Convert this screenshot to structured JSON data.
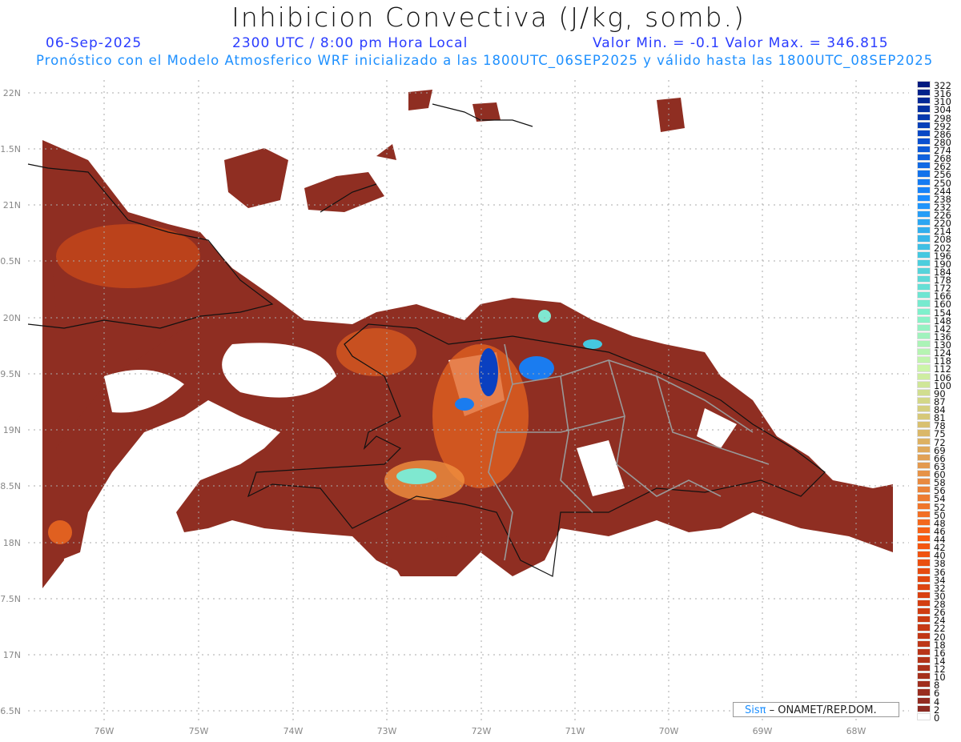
{
  "header": {
    "title": "Inhibicion Convectiva (J/kg, somb.)",
    "date": "06-Sep-2025",
    "time": "2300 UTC / 8:00 pm Hora Local",
    "minmax": "Valor Min. = -0.1  Valor Max. = 346.815",
    "model_line": "Pronóstico con el Modelo Atmosferico WRF inicializado a las 1800UTC_06SEP2025 y válido hasta las  1800UTC_08SEP2025"
  },
  "axes": {
    "lat_labels": [
      "22N",
      "1.5N",
      "21N",
      "0.5N",
      "20N",
      "9.5N",
      "19N",
      "8.5N",
      "18N",
      "7.5N",
      "17N",
      "6.5N"
    ],
    "lon_labels": [
      "76W",
      "75W",
      "74W",
      "73W",
      "72W",
      "71W",
      "70W",
      "69W",
      "68W"
    ]
  },
  "colorbar": {
    "levels": [
      "322",
      "316",
      "310",
      "304",
      "298",
      "292",
      "286",
      "280",
      "274",
      "268",
      "262",
      "256",
      "250",
      "244",
      "238",
      "232",
      "226",
      "220",
      "214",
      "208",
      "202",
      "196",
      "190",
      "184",
      "178",
      "172",
      "166",
      "160",
      "154",
      "148",
      "142",
      "136",
      "130",
      "124",
      "118",
      "112",
      "106",
      "100",
      "90",
      "87",
      "84",
      "81",
      "78",
      "75",
      "72",
      "69",
      "66",
      "63",
      "60",
      "58",
      "56",
      "54",
      "52",
      "50",
      "48",
      "46",
      "44",
      "42",
      "40",
      "38",
      "36",
      "34",
      "32",
      "30",
      "28",
      "26",
      "24",
      "22",
      "20",
      "18",
      "16",
      "14",
      "12",
      "10",
      "8",
      "6",
      "4",
      "2",
      "0"
    ],
    "stops": [
      "#001a80",
      "#0a50d0",
      "#1a8cff",
      "#45c8e0",
      "#7ff0cc",
      "#ccf5a8",
      "#d8c070",
      "#e88a40",
      "#f85a10",
      "#d84010",
      "#b83418",
      "#8c2a22",
      "#ffffff"
    ]
  },
  "credit": {
    "brand": "Sisπ",
    "text": " – ONAMET/REP.DOM."
  },
  "colors": {
    "land_fill": "#8f2e22",
    "mid": "#d8501a",
    "hot": "#f08030",
    "high": "#7fe8d0",
    "extreme": "#0a40c0"
  }
}
